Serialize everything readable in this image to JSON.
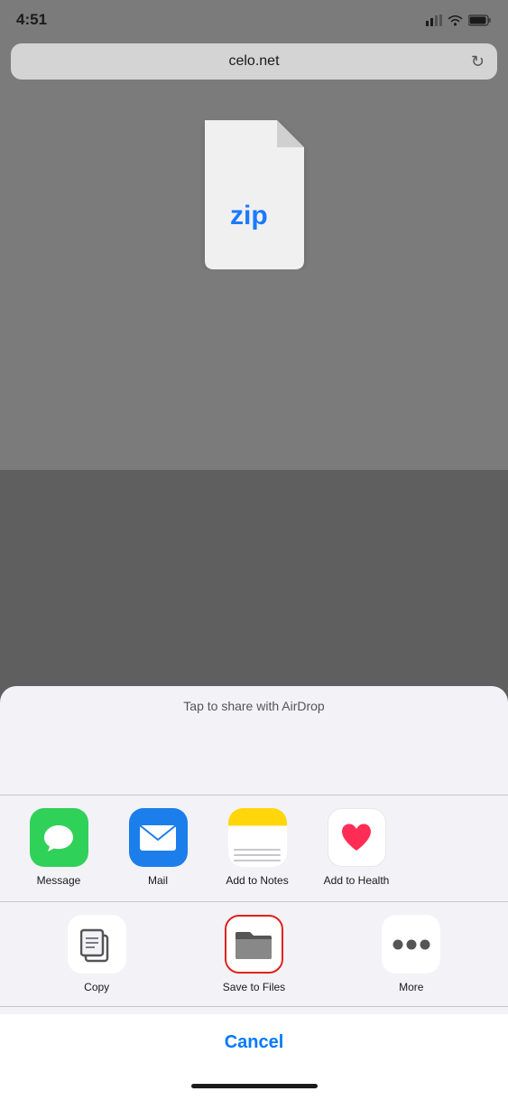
{
  "status_bar": {
    "time": "4:51",
    "signal": "▪▪",
    "wifi": "wifi",
    "battery": "battery"
  },
  "browser": {
    "url": "celo.net",
    "reload_label": "↻"
  },
  "zip_area": {
    "label": "zip"
  },
  "share_sheet": {
    "airdrop_label": "Tap to share with AirDrop",
    "app_row": [
      {
        "id": "message",
        "label": "Message",
        "icon_type": "message"
      },
      {
        "id": "mail",
        "label": "Mail",
        "icon_type": "mail"
      },
      {
        "id": "add-to-notes",
        "label": "Add to Notes",
        "icon_type": "notes"
      },
      {
        "id": "add-to-health",
        "label": "Add to Health",
        "icon_type": "health"
      }
    ],
    "action_row": [
      {
        "id": "copy",
        "label": "Copy",
        "icon_type": "copy",
        "selected": false
      },
      {
        "id": "save-to-files",
        "label": "Save to Files",
        "icon_type": "files",
        "selected": true
      },
      {
        "id": "more",
        "label": "More",
        "icon_type": "more",
        "selected": false
      }
    ],
    "cancel_label": "Cancel"
  }
}
